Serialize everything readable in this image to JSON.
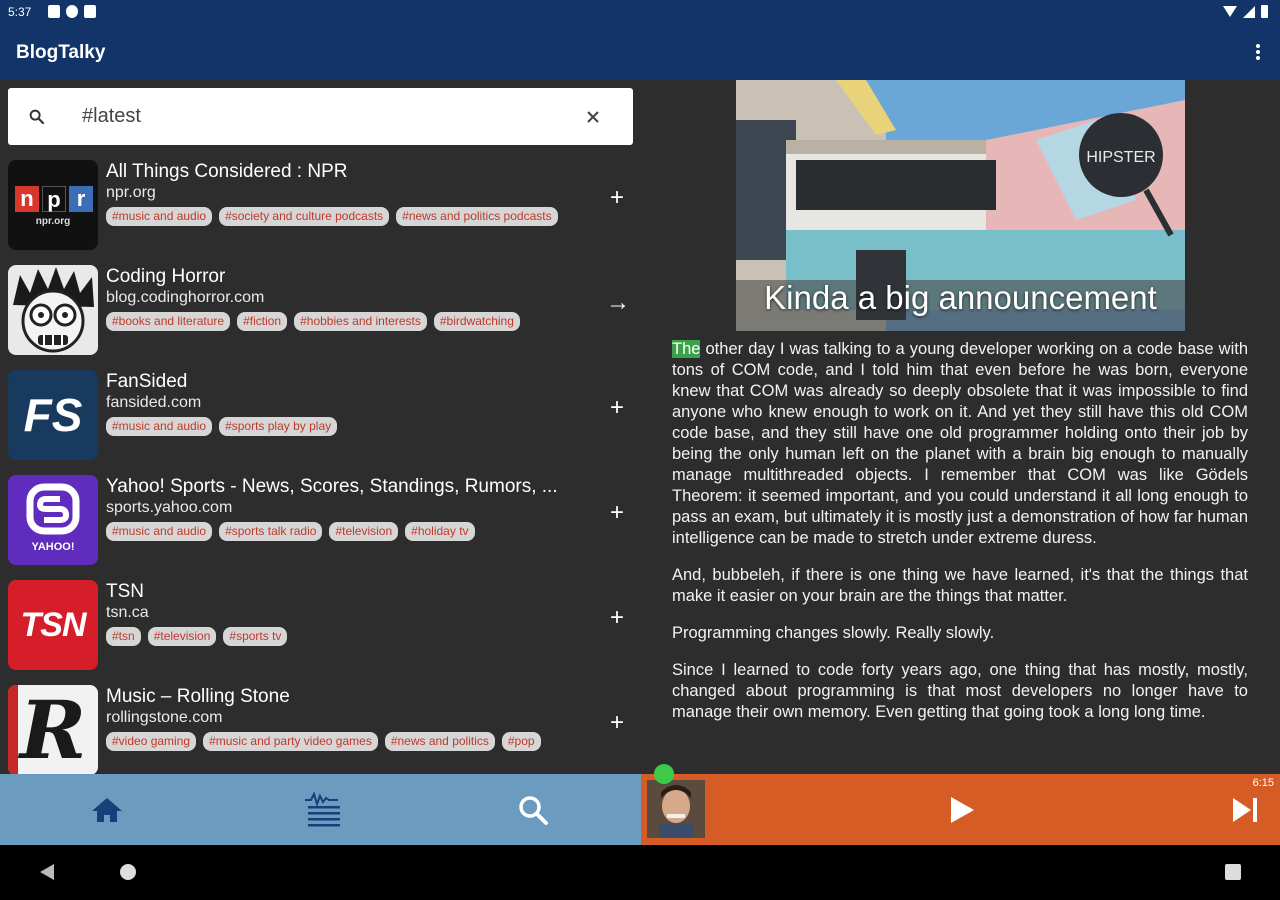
{
  "status_bar": {
    "time": "5:37"
  },
  "app_bar": {
    "title": "BlogTalky"
  },
  "search": {
    "value": "#latest"
  },
  "feeds": [
    {
      "title": "All Things Considered : NPR",
      "url": "npr.org",
      "tags": [
        "#music and audio",
        "#society and culture podcasts",
        "#news and politics podcasts"
      ],
      "action": "+",
      "logo_text": [
        "n",
        "p",
        "r"
      ],
      "logo_sub": "npr.org"
    },
    {
      "title": "Coding Horror",
      "url": "blog.codinghorror.com",
      "tags": [
        "#books and literature",
        "#fiction",
        "#hobbies and interests",
        "#birdwatching"
      ],
      "action": "→"
    },
    {
      "title": "FanSided",
      "url": "fansided.com",
      "tags": [
        "#music and audio",
        "#sports play by play"
      ],
      "action": "+",
      "logo_text": "FS"
    },
    {
      "title": "Yahoo! Sports - News, Scores, Standings, Rumors, ...",
      "url": "sports.yahoo.com",
      "tags": [
        "#music and audio",
        "#sports talk radio",
        "#television",
        "#holiday tv"
      ],
      "action": "+",
      "logo_text": "YAHOO!"
    },
    {
      "title": "TSN",
      "url": "tsn.ca",
      "tags": [
        "#tsn",
        "#television",
        "#sports tv"
      ],
      "action": "+",
      "logo_text": "TSN"
    },
    {
      "title": "Music – Rolling Stone",
      "url": "rollingstone.com",
      "tags": [
        "#video gaming",
        "#music and party video games",
        "#news and politics",
        "#pop"
      ],
      "action": "+",
      "logo_text": "R"
    }
  ],
  "article": {
    "hero_title": "Kinda a big announcement",
    "highlight_word": "The",
    "p1_rest": " other day I was talking to a young developer working on a code base with tons of COM code, and I told him that even before he was born, everyone knew that COM was already so deeply obsolete that it was impossible to find anyone who knew enough to work on it. And yet they still have this old COM code base, and they still have one old programmer holding onto their job by being the only human left on the planet with a brain big enough to manually manage multithreaded objects. I remember that COM was like Gödels Theorem: it seemed important, and you could understand it all long enough to pass an exam, but ultimately it is mostly just a demonstration of how far human intelligence can be made to stretch under extreme duress.",
    "p2": "And, bubbeleh, if there is one thing we have learned, it's that the things that make it easier on your brain are the things that matter.",
    "p3": "Programming changes slowly. Really slowly.",
    "p4": "Since I learned to code forty years ago, one thing that has mostly, mostly, changed about programming is that most developers no longer have to manage their own memory. Even getting that going took a long long time."
  },
  "player": {
    "duration": "6:15"
  },
  "colors": {
    "app_bar": "#123468",
    "panel_bg": "#2d2d2d",
    "bottom_nav": "#6b9cc0",
    "player_bar": "#d55d25",
    "tag_text": "#c0392b",
    "highlight": "#3aa34a"
  }
}
